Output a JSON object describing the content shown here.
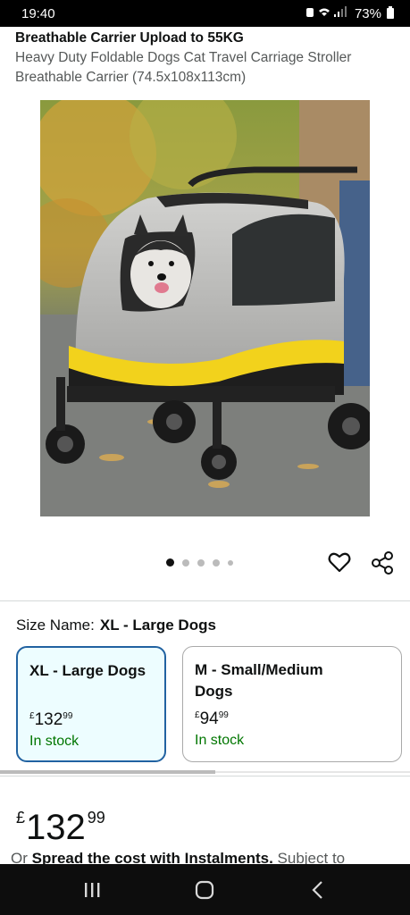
{
  "status": {
    "time": "19:40",
    "battery": "73%"
  },
  "product": {
    "title_truncated": "Breathable Carrier Upload to 55KG",
    "subtitle_line1": "Heavy Duty Foldable Dogs Cat Travel Carriage Stroller",
    "subtitle_line2": "Breathable Carrier (74.5x108x113cm)",
    "image_alt": "dog stroller with husky",
    "gallery_dots": 5,
    "active_dot": 0
  },
  "size": {
    "label": "Size Name:",
    "selected_value": "XL - Large Dogs",
    "options": [
      {
        "name": "XL - Large Dogs",
        "currency": "£",
        "price_whole": "132",
        "price_fraction": "99",
        "stock": "In stock",
        "selected": true
      },
      {
        "name_line1": "M - Small/Medium",
        "name_line2": "Dogs",
        "currency": "£",
        "price_whole": "94",
        "price_fraction": "99",
        "stock": "In stock",
        "selected": false
      }
    ]
  },
  "price": {
    "currency": "£",
    "whole": "132",
    "fraction": "99"
  },
  "instalment": {
    "prefix": "Or",
    "link": "Spread the cost with Instalments.",
    "suffix": "Subject to"
  },
  "colors": {
    "selected_border": "#2162a1",
    "in_stock": "#007600"
  },
  "icons": [
    "heart-icon",
    "share-icon",
    "recents-icon",
    "home-icon",
    "back-icon"
  ]
}
